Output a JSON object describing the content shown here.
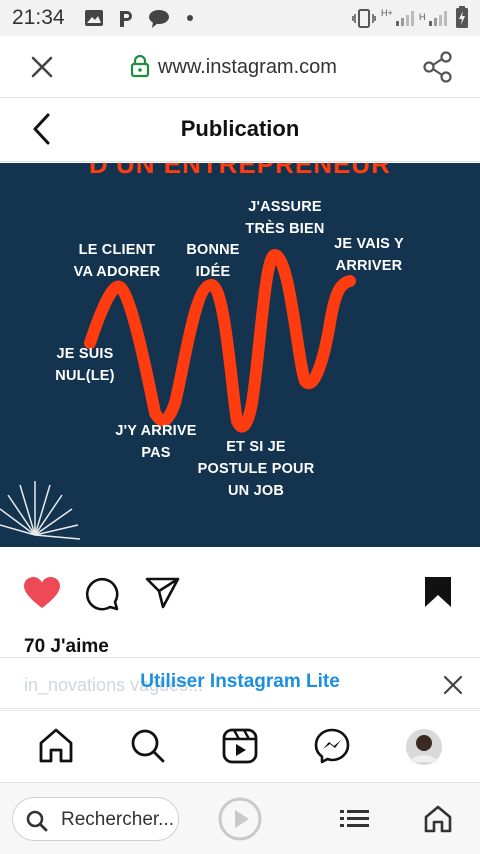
{
  "status_bar": {
    "time": "21:34",
    "net_label": "H+",
    "net_label2": "H"
  },
  "browser": {
    "url": "www.instagram.com"
  },
  "header": {
    "title": "Publication"
  },
  "post": {
    "top_partial_text": "D'UN ENTREPRENEUR",
    "labels": {
      "le_client": [
        "LE CLIENT",
        "VA ADORER"
      ],
      "bonne_idee": [
        "BONNE",
        "IDÉE"
      ],
      "j_assure": [
        "J'ASSURE",
        "TRÈS BIEN"
      ],
      "je_vais": [
        "JE VAIS Y",
        "ARRIVER"
      ],
      "je_suis": [
        "JE SUIS",
        "NUL(LE)"
      ],
      "j_y_arrive": [
        "J'Y ARRIVE",
        "PAS"
      ],
      "et_si": [
        "ET SI JE",
        "POSTULE POUR",
        "UN JOB"
      ]
    },
    "colors": {
      "background": "#13334f",
      "accent": "#ff3b10"
    }
  },
  "actions": {
    "likes": "70 J'aime"
  },
  "banner": {
    "ghost_text": "in_novations                               vagues...",
    "cta": "Utiliser Instagram Lite"
  },
  "nav": {
    "items": [
      "home-icon",
      "search-icon",
      "reels-icon",
      "messenger-icon",
      "profile-avatar"
    ]
  },
  "browser_bottom": {
    "search_placeholder": "Rechercher..."
  },
  "icons": {
    "close": "close-icon",
    "lock": "lock-icon",
    "share": "share-icon",
    "back": "back-arrow-icon",
    "heart": "heart-icon",
    "comment": "comment-icon",
    "send": "send-icon",
    "bookmark": "bookmark-icon"
  }
}
